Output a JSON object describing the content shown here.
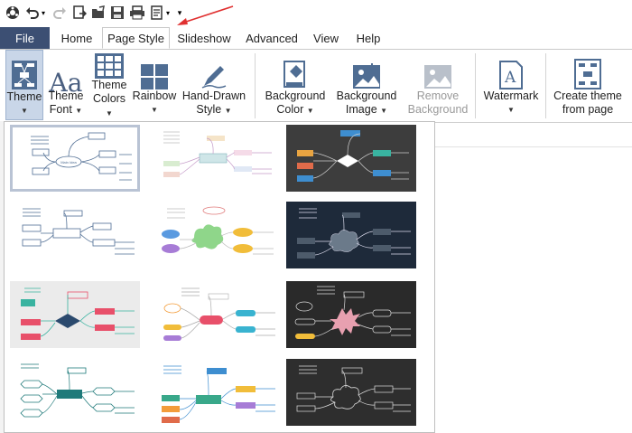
{
  "quick_access": {
    "icons": [
      "app-logo-icon",
      "undo-icon",
      "undo-dropdown-icon",
      "redo-icon",
      "export-icon",
      "open-icon",
      "save-icon",
      "print-icon",
      "document-icon",
      "customize-dropdown-icon"
    ]
  },
  "menu": {
    "file": "File",
    "tabs": [
      "Home",
      "Page Style",
      "Slideshow",
      "Advanced",
      "View",
      "Help"
    ],
    "active_tab": "Page Style"
  },
  "ribbon": {
    "theme": {
      "line1": "Theme",
      "line2": ""
    },
    "theme_font": {
      "line1": "Theme",
      "line2": "Font"
    },
    "theme_colors": {
      "line1": "Theme",
      "line2": "Colors"
    },
    "rainbow": {
      "line1": "Rainbow",
      "line2": ""
    },
    "hand_drawn": {
      "line1": "Hand-Drawn",
      "line2": "Style"
    },
    "background_color": {
      "line1": "Background",
      "line2": "Color"
    },
    "background_image": {
      "line1": "Background",
      "line2": "Image"
    },
    "remove_background": {
      "line1": "Remove",
      "line2": "Background"
    },
    "watermark": {
      "line1": "Watermark",
      "line2": ""
    },
    "create_theme": {
      "line1": "Create theme",
      "line2": "from page"
    }
  },
  "gallery": {
    "main_idea": "Main Idea",
    "main_topic": "Main Topic",
    "floating_topic": "Floating"
  },
  "colors": {
    "file_tab_bg": "#3c4f73",
    "selected_button_bg": "#c9d6e8",
    "annotation_arrow": "#e03030"
  }
}
